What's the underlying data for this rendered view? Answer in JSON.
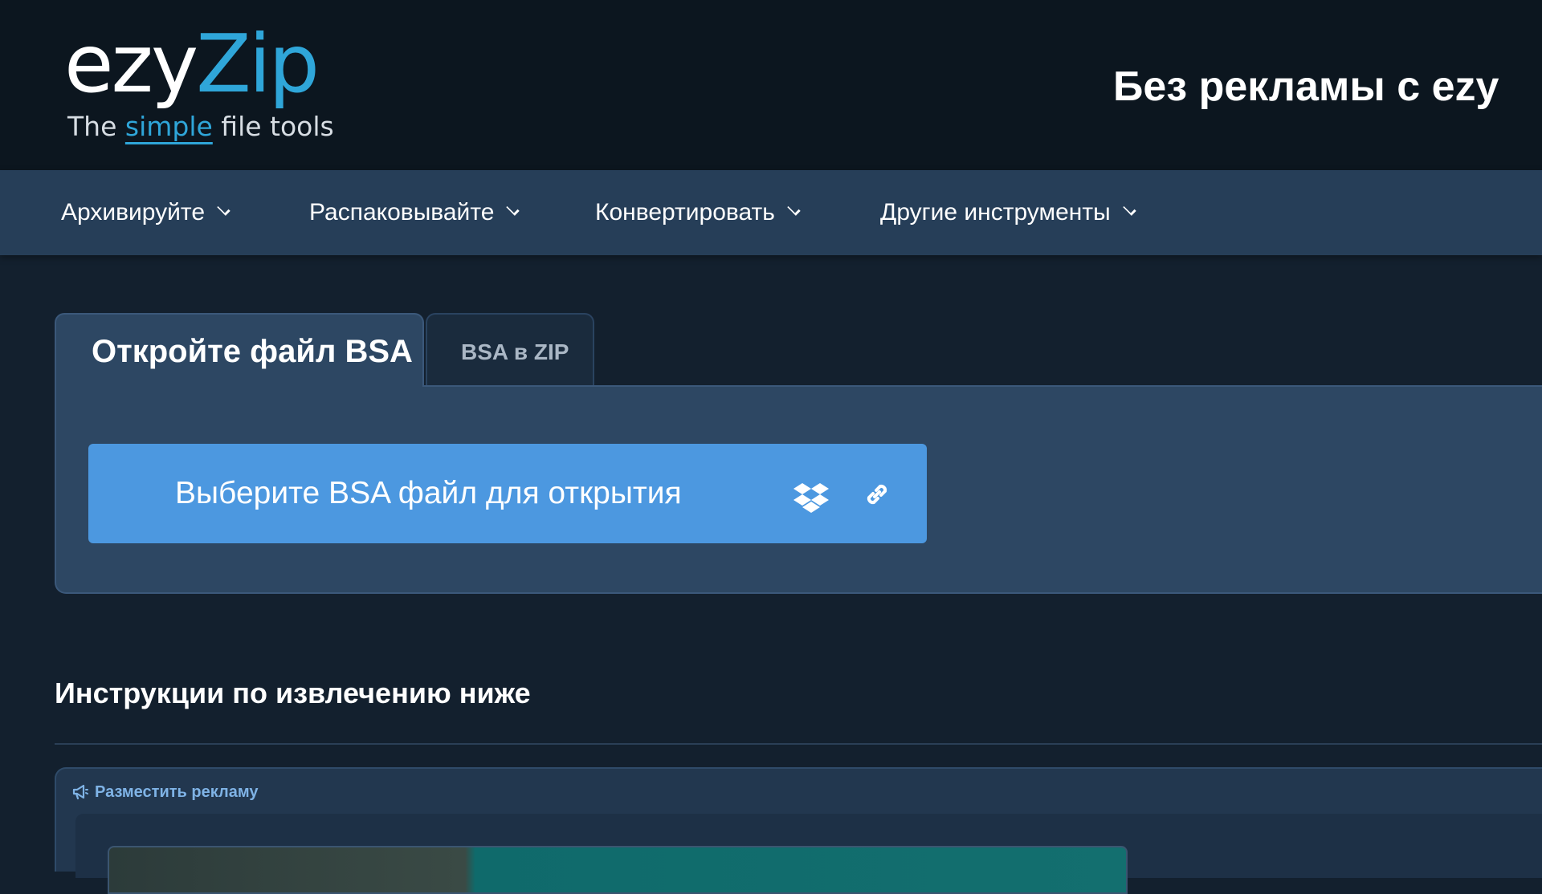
{
  "logo": {
    "brand_part1": "ezy",
    "brand_part2": "Zip",
    "tagline_before": "The ",
    "tagline_highlight": "simple",
    "tagline_after": " file tools",
    "colors": {
      "accent": "#2fa6d9",
      "text": "#ffffff"
    }
  },
  "nav": {
    "items": [
      {
        "label": "Архивируйте"
      },
      {
        "label": "Распаковывайте"
      },
      {
        "label": "Конвертировать"
      },
      {
        "label": "Другие инструменты"
      }
    ]
  },
  "tabs": [
    {
      "label": "Откройте файл BSA",
      "active": true
    },
    {
      "label": "BSA в ZIP",
      "active": false
    }
  ],
  "upload": {
    "label": "Выберите BSA файл для открытия",
    "icons": [
      "dropbox-icon",
      "link-icon"
    ],
    "color": "#4c98e0"
  },
  "instructions": {
    "title": "Инструкции по извлечению ниже"
  },
  "ad": {
    "label": "Разместить рекламу",
    "icon": "megaphone-icon",
    "heading_partial": "Без рекламы с ezy"
  }
}
